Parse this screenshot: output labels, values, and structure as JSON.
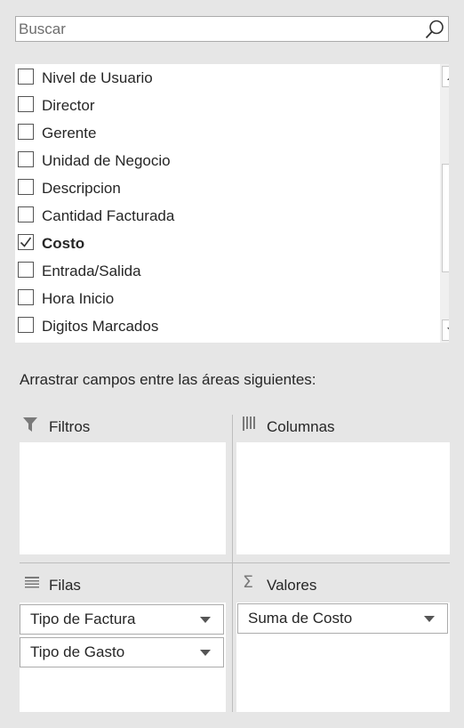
{
  "search": {
    "placeholder": "Buscar",
    "icon": "search-icon"
  },
  "fields": [
    {
      "label": "Nivel de Usuario",
      "checked": false
    },
    {
      "label": "Director",
      "checked": false
    },
    {
      "label": "Gerente",
      "checked": false
    },
    {
      "label": "Unidad de Negocio",
      "checked": false
    },
    {
      "label": "Descripcion",
      "checked": false
    },
    {
      "label": "Cantidad Facturada",
      "checked": false
    },
    {
      "label": "Costo",
      "checked": true
    },
    {
      "label": "Entrada/Salida",
      "checked": false
    },
    {
      "label": "Hora Inicio",
      "checked": false
    },
    {
      "label": "Digitos Marcados",
      "checked": false
    }
  ],
  "hint": "Arrastrar campos entre las áreas siguientes:",
  "areas": {
    "filters": {
      "title": "Filtros",
      "icon": "filter-icon"
    },
    "columns": {
      "title": "Columnas",
      "icon": "columns-icon"
    },
    "rows": {
      "title": "Filas",
      "icon": "rows-icon",
      "items": [
        "Tipo de Factura",
        "Tipo de Gasto"
      ]
    },
    "values": {
      "title": "Valores",
      "icon": "sigma-icon",
      "items": [
        "Suma de Costo"
      ]
    }
  },
  "colors": {
    "background": "#e6e6e6",
    "panel": "#ffffff",
    "border": "#ababab",
    "icon": "#7a7a7a"
  }
}
